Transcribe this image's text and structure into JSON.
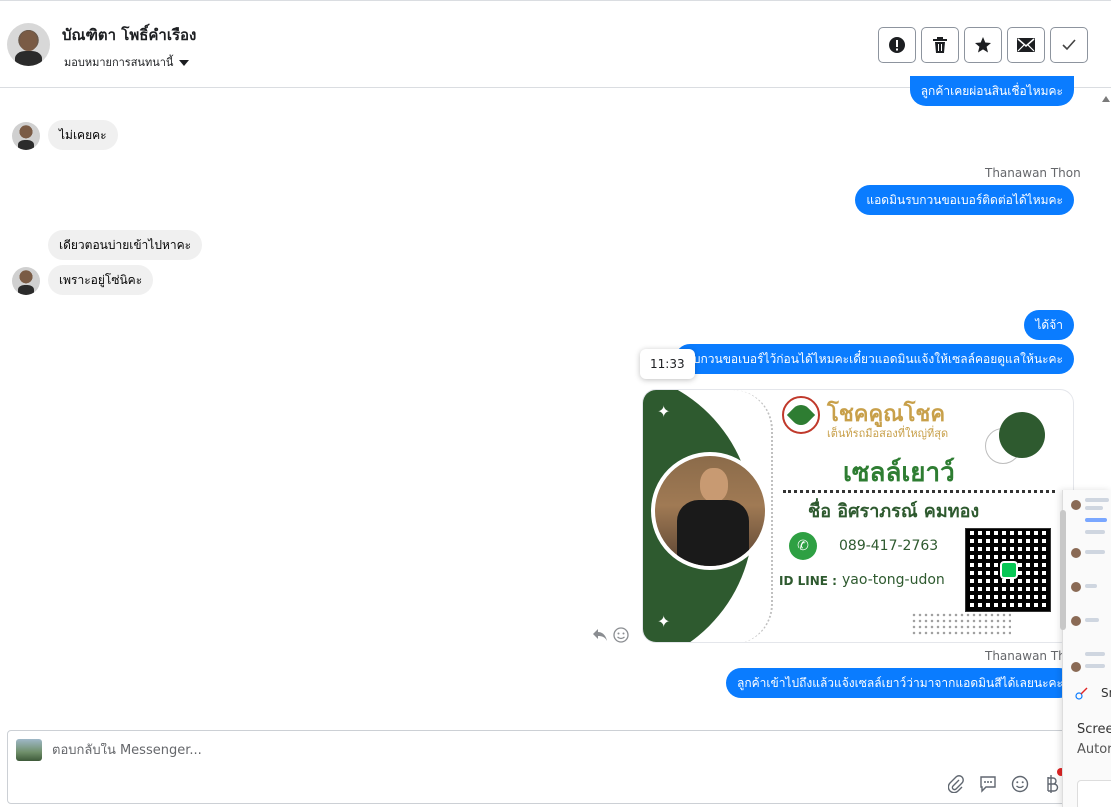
{
  "header": {
    "contact_name": "บัณฑิตา โพธิ์คำเรือง",
    "assign_label": "มอบหมายการสนทนานี้",
    "buttons": [
      {
        "name": "mark-spam-button",
        "icon": "exclamation-icon"
      },
      {
        "name": "delete-button",
        "icon": "trash-icon"
      },
      {
        "name": "star-button",
        "icon": "star-icon"
      },
      {
        "name": "mark-unread-button",
        "icon": "envelope-icon"
      },
      {
        "name": "mark-done-button",
        "icon": "check-icon"
      }
    ]
  },
  "messages": {
    "m0_out": "ลูกค้าเคยผ่อนสินเชื่อไหมคะ",
    "m1_in": "ไม่เคยคะ",
    "sender_1": "Thanawan Thon",
    "m2_out": "แอดมินรบกวนขอเบอร์ติดต่อได้ไหมคะ",
    "m3_in": "เดียวตอนบ่ายเข้าไปหาคะ",
    "m4_in": "เพราะอยู่โซ่นิคะ",
    "m5_out": "ได้จ้า",
    "m6_out": "รบกวนขอเบอร์ไว้ก่อนได้ไหมคะเดี๋ยวแอดมินแจ้งให้เซลล์คอยดูแลให้นะคะ",
    "timestamp": "11:33",
    "sender_2": "Thanawan Thon",
    "m7_out": "ลูกค้าเข้าไปถึงแล้วแจ้งเซลล์เยาว์ว่ามาจากแอดมินสีได้เลยนะคะ"
  },
  "card": {
    "brand": "โชคคูณโชค",
    "tagline": "เต็นท์รถมือสองที่ใหญ่ที่สุด",
    "title": "เซลล์เยาว์",
    "person": "ชื่อ อิศราภรณ์  คมทอง",
    "phone": "089-417-2763",
    "idline_label": "ID LINE :",
    "idline": "yao-tong-udon"
  },
  "composer": {
    "placeholder": "ตอบกลับใน Messenger..."
  },
  "overlay": {
    "text1": "Sn",
    "text2": "Scree",
    "text3": "Autor"
  },
  "colors": {
    "accent": "#0a7cff",
    "incoming_bg": "#f0f0f0",
    "card_green": "#2e5a2f",
    "card_gold": "#c8a04a"
  }
}
